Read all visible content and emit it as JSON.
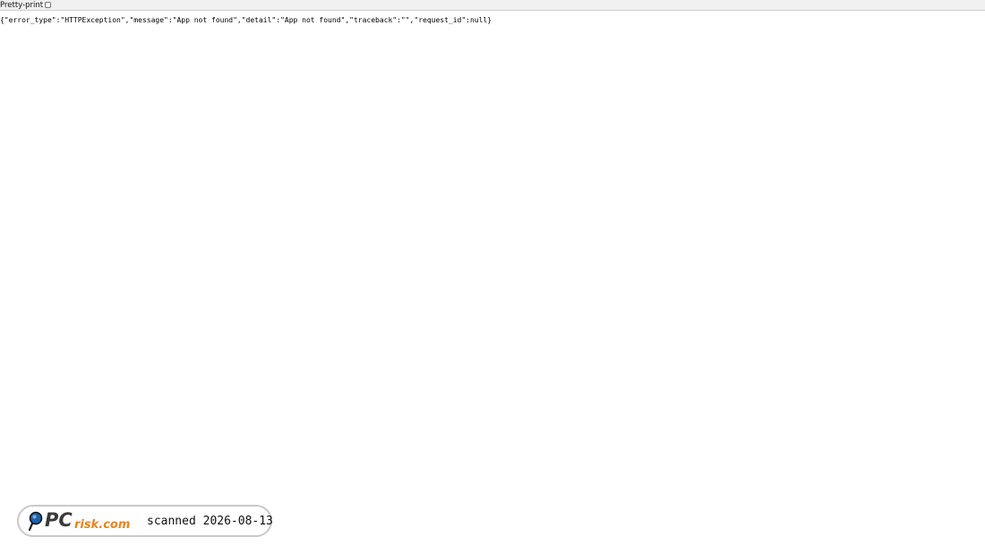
{
  "toolbar": {
    "pretty_print_label": "Pretty-print",
    "pretty_print_checked": false
  },
  "response": {
    "raw_json": "{\"error_type\":\"HTTPException\",\"message\":\"App not found\",\"detail\":\"App not found\",\"traceback\":\"\",\"request_id\":null}"
  },
  "watermark": {
    "logo_text": "PCrisk.com",
    "scan_text": "scanned 2026-08-13",
    "logo_colors": {
      "pc": "#3a3a3a",
      "risk": "#e8841a",
      "magnifier": "#1f5fa8"
    }
  }
}
